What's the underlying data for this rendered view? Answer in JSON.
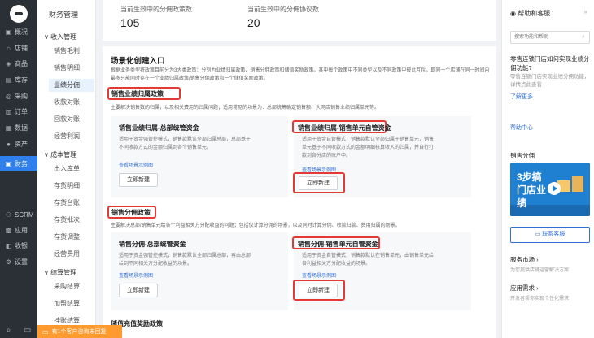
{
  "nav": {
    "items": [
      {
        "icon": "▣",
        "label": "概况"
      },
      {
        "icon": "⌂",
        "label": "店铺"
      },
      {
        "icon": "◈",
        "label": "商品"
      },
      {
        "icon": "▤",
        "label": "库存"
      },
      {
        "icon": "◎",
        "label": "采购"
      },
      {
        "icon": "▥",
        "label": "订单"
      },
      {
        "icon": "▦",
        "label": "数据"
      },
      {
        "icon": "●",
        "label": "资产"
      },
      {
        "icon": "▣",
        "label": "财务"
      },
      {
        "icon": "⚇",
        "label": "SCRM"
      },
      {
        "icon": "▩",
        "label": "应用"
      },
      {
        "icon": "◧",
        "label": "收银"
      },
      {
        "icon": "⚙",
        "label": "设置"
      }
    ],
    "bottom_icons": [
      "search-icon",
      "chat-icon",
      "grid-icon"
    ]
  },
  "subnav": {
    "title": "财务管理",
    "groups": [
      {
        "label": "∨ 收入管理",
        "items": [
          "销售毛利",
          "销售明细",
          "业绩分佣",
          "收款对账",
          "回款对账",
          "经营利润"
        ]
      },
      {
        "label": "∨ 成本管理",
        "items": [
          "出入库单",
          "存货明细",
          "存货台账",
          "存货批次",
          "存货调整",
          "经营费用"
        ]
      },
      {
        "label": "∨ 结算管理",
        "items": [
          "采购结算",
          "加盟结算",
          "挂账结算"
        ]
      }
    ]
  },
  "stats": [
    {
      "label": "当前生效中的分佣政策数",
      "value": "105"
    },
    {
      "label": "当前生效中的分佣协议数",
      "value": "20"
    }
  ],
  "scene": {
    "title": "场景化创建入口",
    "desc": "根据业务类型将政策目前分为3大类政策：分别为业绩归属政策、销售分佣政策和储值奖励政策。其中每个政策中不同类型以及不同政策中彼此互斥，即同一个店铺在同一时间内最多只能同时存在一个业绩归属政策/销售分佣政策和一个储值奖励政策。",
    "sections": [
      {
        "title": "销售业绩归属政策",
        "desc": "主要解决销售数的归属，以及相关费用的归属问题；适用常见的场景为：总部统筹确定销售额、大网店销售业绩归属单元等。",
        "options": [
          {
            "title": "销售业绩归属-总部统管资金",
            "text": "适用于资金强管控模式，销售款默认全部归属总部，总部基于不同收款方式的金额归属到各个销售单元。",
            "link": "查看场景示例图",
            "button": "立即新建"
          },
          {
            "title": "销售业绩归属-销售单元自管资金",
            "text": "适用于资金自管模式，销售款默认全部归属于销售单元，销售单元基于不同收款方式的金额明细核算收入的归属，并自行打款到各分店的账户中。",
            "link": "查看场景示例图",
            "button": "立即新建"
          }
        ]
      },
      {
        "title": "销售分佣政策",
        "desc": "主要解决总部/销售单元给各个利益相关方分配收益的问题；包括仅计算分佣的场景，以及同时计算分佣、收款归款、费用归属的场景。",
        "options": [
          {
            "title": "销售分佣-总部统管资金",
            "text": "适用于资金强管控模式，销售款默认全部归属总部，再由总部给到不同相关方分配收益的场景。",
            "link": "查看场景示例图",
            "button": "立即新建"
          },
          {
            "title": "销售分佣-销售单元自管资金",
            "text": "适用于资金自管模式，销售款默认在销售单元，由销售单元给各利益相关方分配收益的场景。",
            "link": "查看场景示例图",
            "button": "立即新建"
          }
        ]
      }
    ],
    "bottom_title": "储值充值奖励政策"
  },
  "toast": {
    "text": "有1个客户咨询未回复"
  },
  "help": {
    "title": "帮助和客服",
    "collapse": "»",
    "search_placeholder": "搜索功能和帮助",
    "question": "零售连锁门店如何实现业绩分佣功能?",
    "answer": "零售连锁门店实现业绩分佣功能，详情点此查看",
    "more_link": "了解更多",
    "center_link": "帮助中心",
    "video_title": "销售分佣",
    "video_text": "3步搞门店业绩",
    "contact_button": "联系客服",
    "service_market": "服务市场 ›",
    "service_market_sub": "为您提供店铺运营解决方案",
    "app_need": "应用需求 ›",
    "app_need_sub": "开发者帮你实现个性化需求"
  }
}
